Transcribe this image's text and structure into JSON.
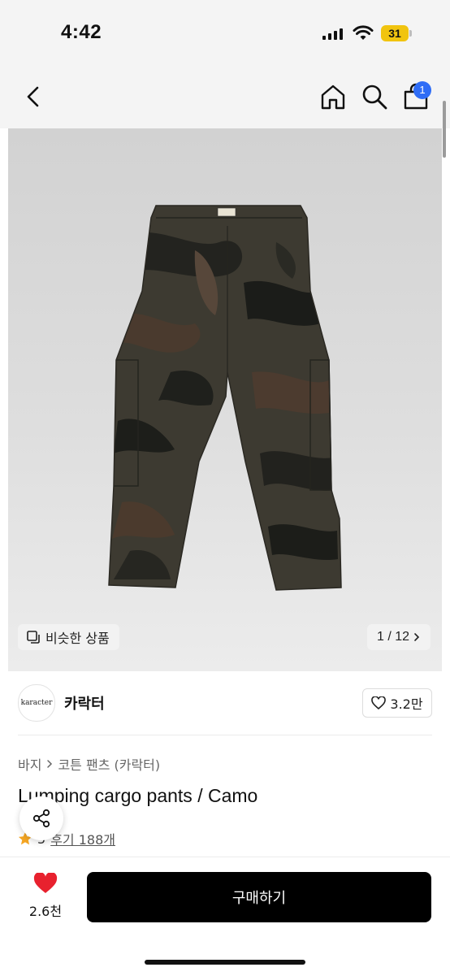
{
  "status_bar": {
    "time": "4:42",
    "battery": "31"
  },
  "nav": {
    "cart_count": "1"
  },
  "hero": {
    "similar_label": "비슷한 상품",
    "pager": "1 / 12",
    "tag_text": "karacter"
  },
  "brand": {
    "logo_text": "karacter",
    "name": "카락터",
    "likes": "3.2만"
  },
  "product": {
    "breadcrumb": [
      "바지",
      "코튼 팬츠 (카락터)"
    ],
    "title": "Lumping cargo pants / Camo",
    "rating": "5",
    "reviews": "후기 188개"
  },
  "bottom": {
    "wish_count": "2.6천",
    "buy_label": "구매하기"
  },
  "colors": {
    "accent": "#2f6df6",
    "wish_heart": "#e8212e",
    "star": "#f5a623"
  }
}
